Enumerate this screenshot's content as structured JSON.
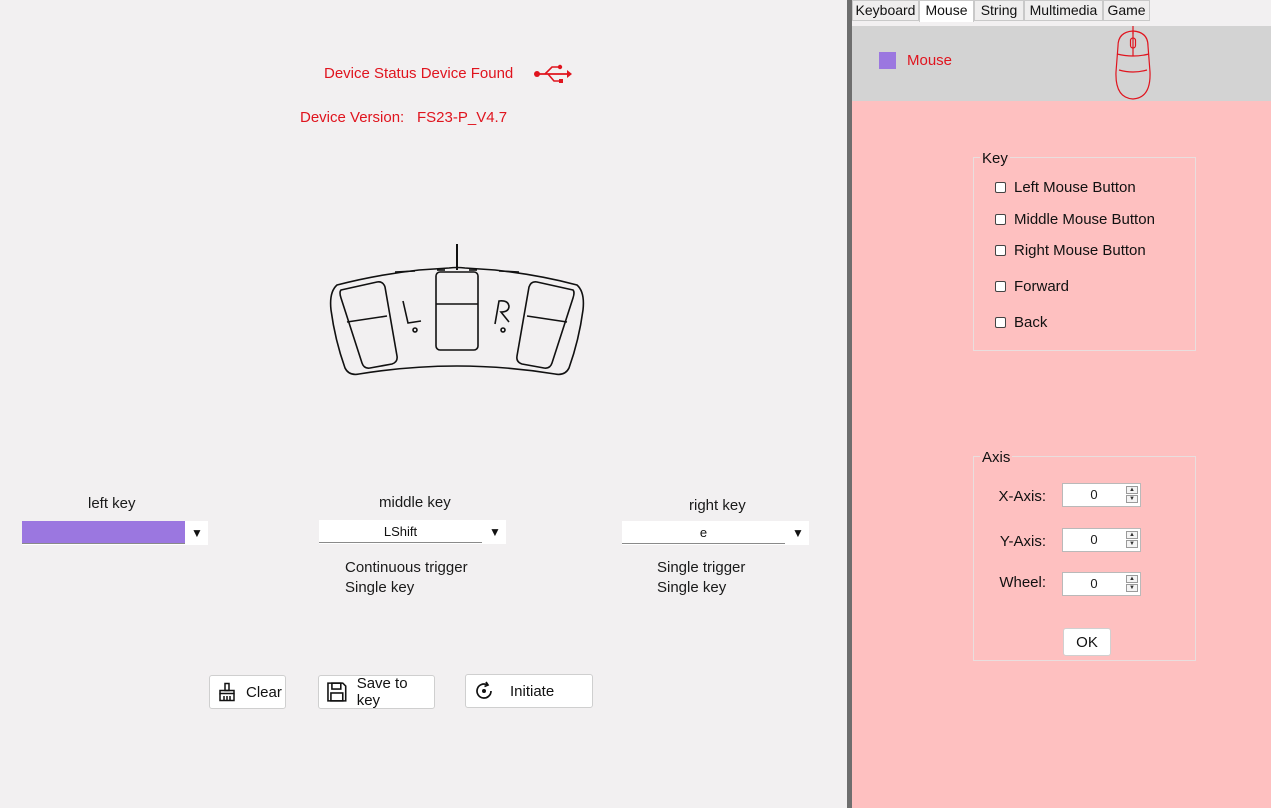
{
  "status": {
    "device_status": "Device Status Device Found",
    "version_label": "Device Version:",
    "version_value": "FS23-P_V4.7",
    "usb_icon": "usb-icon"
  },
  "keys": {
    "left": {
      "label": "left key",
      "value": "",
      "highlight": "#9b77e0"
    },
    "middle": {
      "label": "middle key",
      "value": "LShift",
      "trigger": "Continuous trigger",
      "mode": "Single key"
    },
    "right": {
      "label": "right key",
      "value": "e",
      "trigger": "Single trigger",
      "mode": "Single key"
    }
  },
  "pedal": {
    "left_letter": "L",
    "right_letter": "R"
  },
  "buttons": {
    "clear": "Clear",
    "save": "Save to key",
    "initiate": "Initiate"
  },
  "tabs": [
    "Keyboard",
    "Mouse",
    "String",
    "Multimedia",
    "Game"
  ],
  "active_tab": "Mouse",
  "mouse_panel": {
    "title": "Mouse",
    "swatch": "#9b77e0",
    "key_group": "Key",
    "checkboxes": [
      "Left Mouse Button",
      "Middle Mouse Button",
      "Right Mouse Button",
      "Forward",
      "Back"
    ],
    "axis_group": "Axis",
    "axes": [
      {
        "label": "X-Axis:",
        "value": "0"
      },
      {
        "label": "Y-Axis:",
        "value": "0"
      },
      {
        "label": "Wheel:",
        "value": "0"
      }
    ],
    "ok": "OK"
  },
  "colors": {
    "accent_red": "#e0141e",
    "panel_pink": "#fec0c0",
    "header_gray": "#d3d3d3"
  }
}
